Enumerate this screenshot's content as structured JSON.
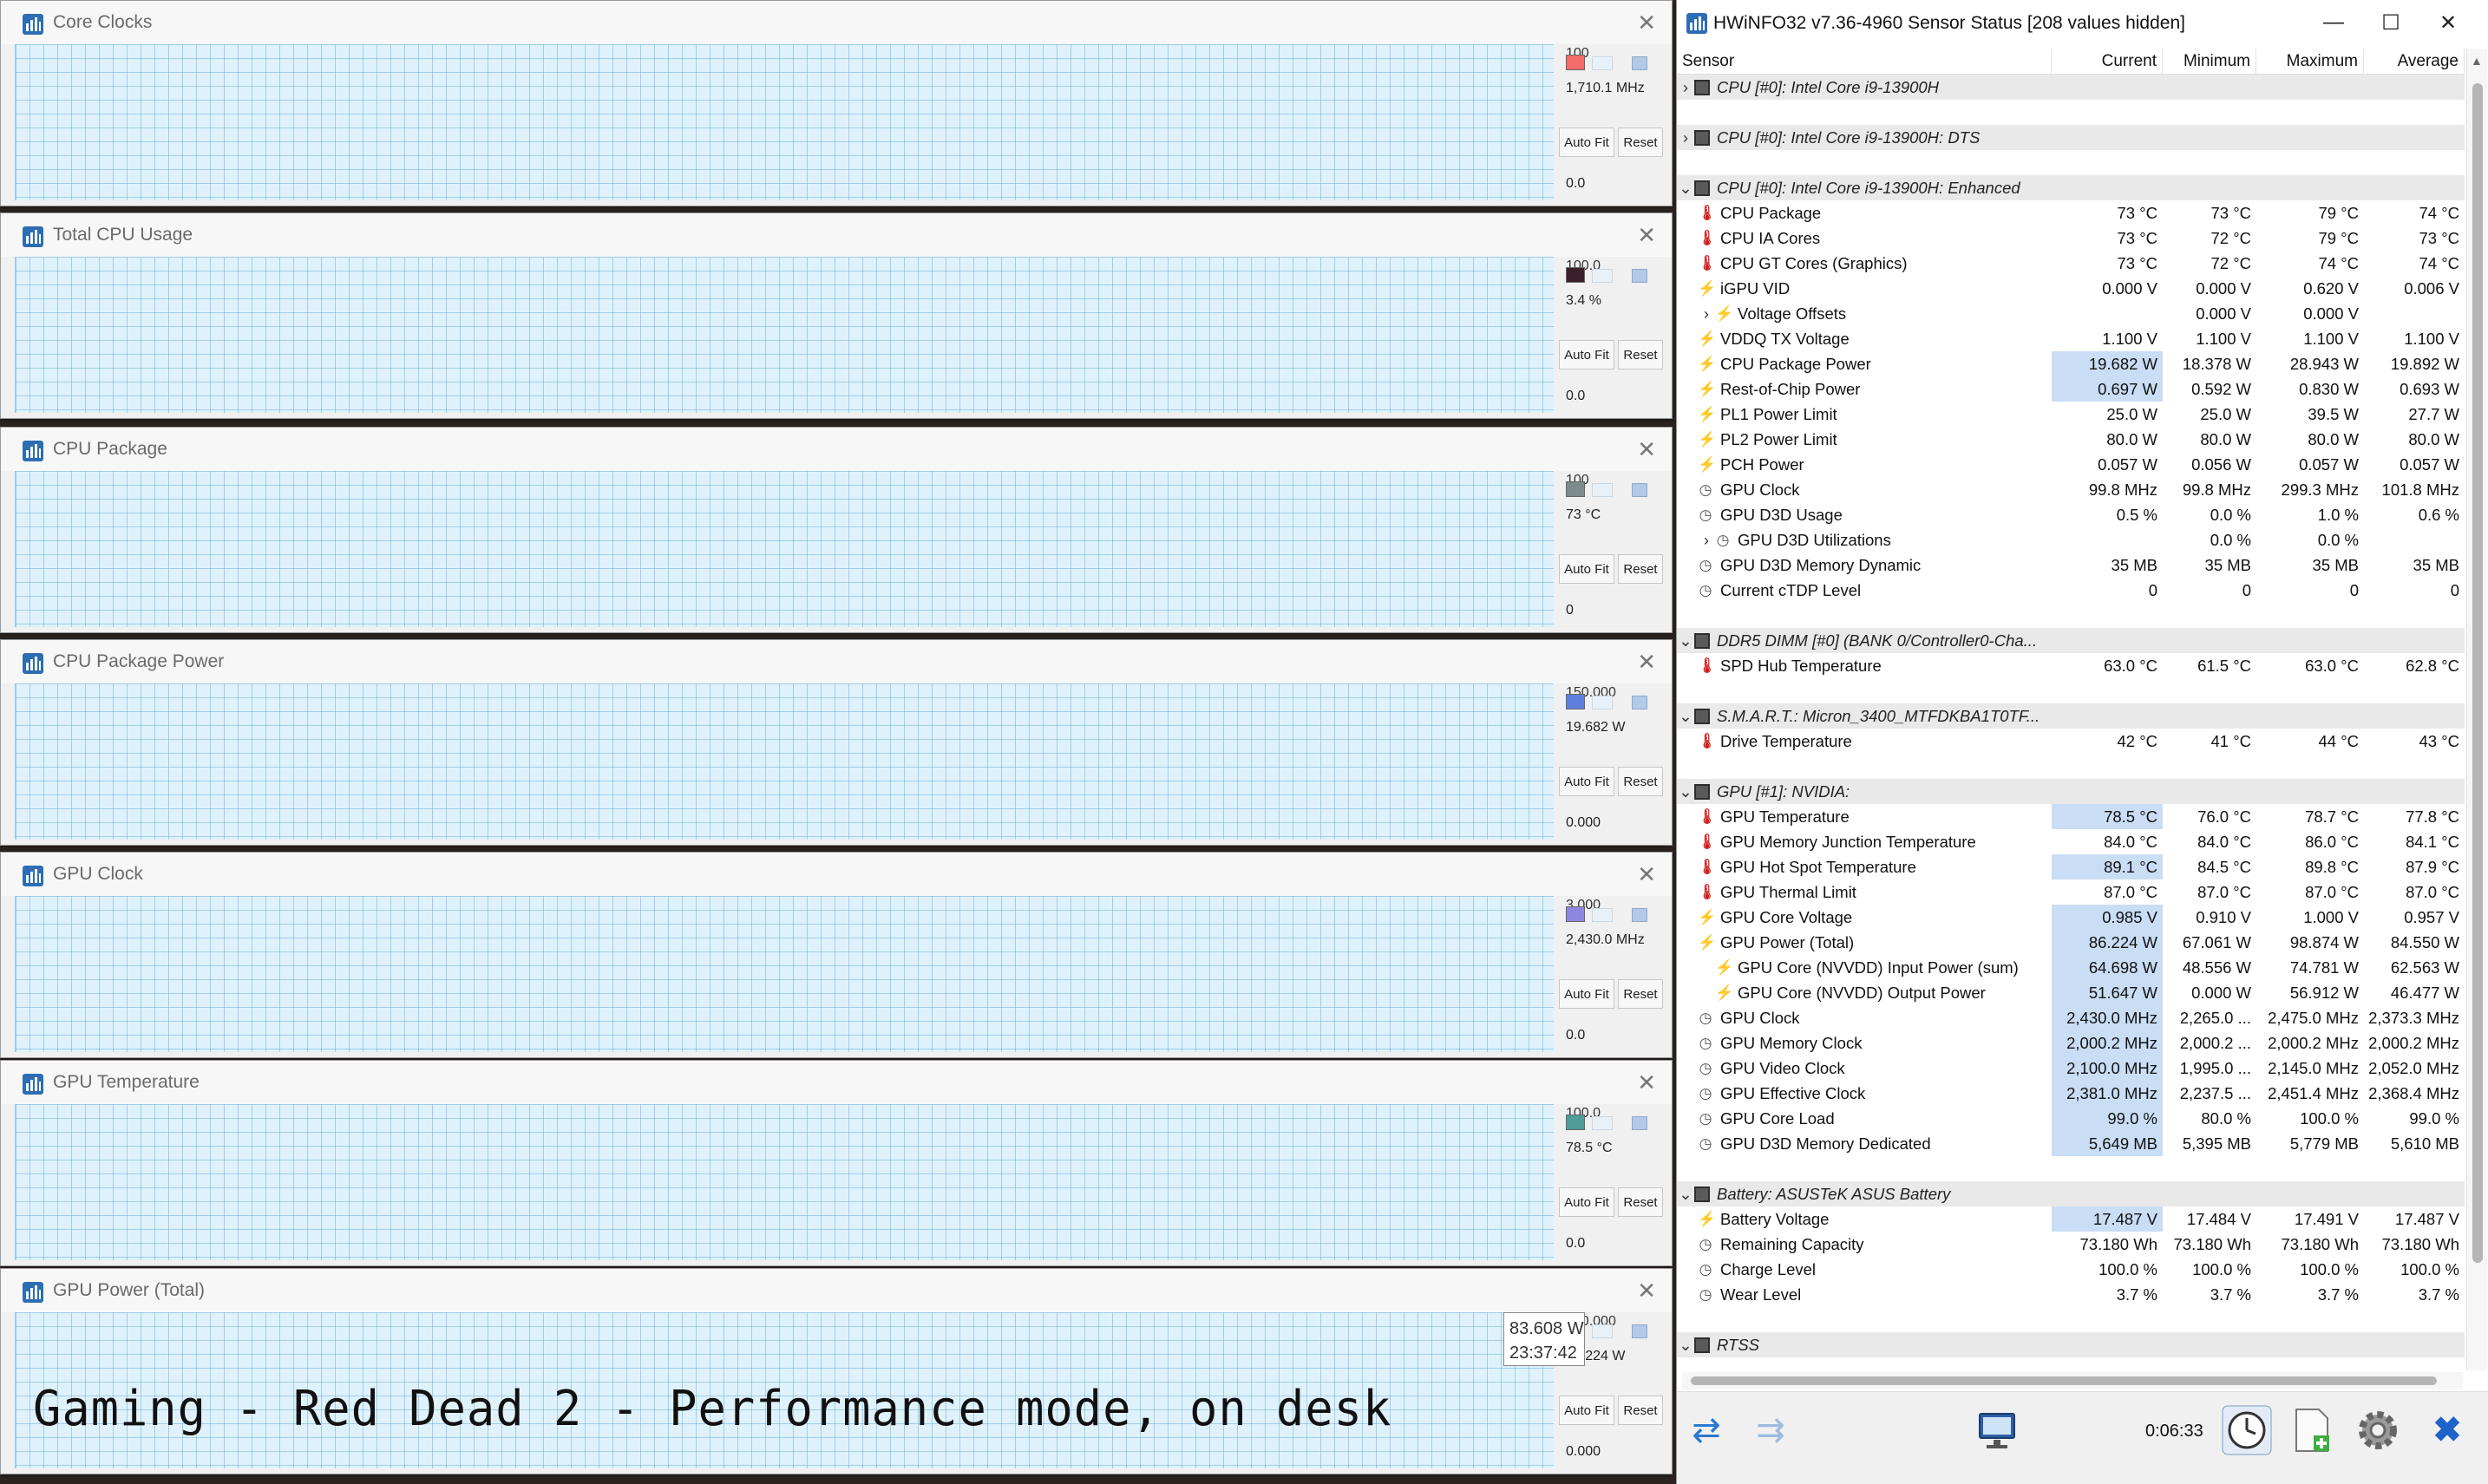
{
  "graphs": [
    {
      "title": "Core Clocks",
      "max": "100",
      "current": "1,710.1 MHz",
      "min": "0.0",
      "color": "#f46c6c",
      "fill": "#f4a3a3"
    },
    {
      "title": "Total CPU Usage",
      "max": "100.0",
      "current": "3.4 %",
      "min": "0.0",
      "color": "#3a1f2a",
      "fill": "#b9d6e6"
    },
    {
      "title": "CPU Package",
      "max": "100",
      "current": "73 °C",
      "min": "0",
      "color": "#7c8c8c",
      "fill": "#a9b4b4"
    },
    {
      "title": "CPU Package Power",
      "max": "150.000",
      "current": "19.682 W",
      "min": "0.000",
      "color": "#5f7fdf",
      "fill": "#8fa6e8"
    },
    {
      "title": "GPU Clock",
      "max": "3,000",
      "current": "2,430.0 MHz",
      "min": "0.0",
      "color": "#8f87e0",
      "fill": "#aca8ec"
    },
    {
      "title": "GPU Temperature",
      "max": "100.0",
      "current": "78.5 °C",
      "min": "0.0",
      "color": "#4f9c98",
      "fill": "#9fb9b7"
    },
    {
      "title": "GPU Power (Total)",
      "max": "200.000",
      "current": "84.224 W",
      "min": "0.000",
      "color": "#5a6a8a",
      "fill": "#9aa7bd"
    }
  ],
  "buttons": {
    "autofit": "Auto Fit",
    "reset": "Reset"
  },
  "tooltip": {
    "value": "83.608 W",
    "time": "23:37:42"
  },
  "caption": "Gaming - Red Dead 2 - Performance mode, on desk",
  "hwinfo": {
    "title": "HWiNFO32 v7.36-4960 Sensor Status [208 values hidden]",
    "columns": {
      "sensor": "Sensor",
      "current": "Current",
      "minimum": "Minimum",
      "maximum": "Maximum",
      "average": "Average"
    },
    "timer": "0:06:33"
  },
  "rows": [
    {
      "type": "group",
      "name": "CPU [#0]: Intel Core i9-13900H",
      "expand": "›"
    },
    {
      "type": "spacer"
    },
    {
      "type": "group",
      "name": "CPU [#0]: Intel Core i9-13900H: DTS",
      "expand": "›"
    },
    {
      "type": "spacer"
    },
    {
      "type": "group",
      "name": "CPU [#0]: Intel Core i9-13900H: Enhanced",
      "expand": "⌄"
    },
    {
      "type": "therm",
      "name": "CPU Package",
      "cur": "73 °C",
      "min": "73 °C",
      "max": "79 °C",
      "avg": "74 °C"
    },
    {
      "type": "therm",
      "name": "CPU IA Cores",
      "cur": "73 °C",
      "min": "72 °C",
      "max": "79 °C",
      "avg": "73 °C"
    },
    {
      "type": "therm",
      "name": "CPU GT Cores (Graphics)",
      "cur": "73 °C",
      "min": "72 °C",
      "max": "74 °C",
      "avg": "74 °C"
    },
    {
      "type": "volt",
      "name": "iGPU VID",
      "cur": "0.000 V",
      "min": "0.000 V",
      "max": "0.620 V",
      "avg": "0.006 V"
    },
    {
      "type": "volt",
      "name": "Voltage Offsets",
      "indent": 1,
      "expand": "›",
      "cur": "",
      "min": "0.000 V",
      "max": "0.000 V",
      "avg": ""
    },
    {
      "type": "volt",
      "name": "VDDQ TX Voltage",
      "cur": "1.100 V",
      "min": "1.100 V",
      "max": "1.100 V",
      "avg": "1.100 V"
    },
    {
      "type": "volt",
      "name": "CPU Package Power",
      "hl": true,
      "cur": "19.682 W",
      "min": "18.378 W",
      "max": "28.943 W",
      "avg": "19.892 W"
    },
    {
      "type": "volt",
      "name": "Rest-of-Chip Power",
      "hl": true,
      "cur": "0.697 W",
      "min": "0.592 W",
      "max": "0.830 W",
      "avg": "0.693 W"
    },
    {
      "type": "volt",
      "name": "PL1 Power Limit",
      "cur": "25.0 W",
      "min": "25.0 W",
      "max": "39.5 W",
      "avg": "27.7 W"
    },
    {
      "type": "volt",
      "name": "PL2 Power Limit",
      "cur": "80.0 W",
      "min": "80.0 W",
      "max": "80.0 W",
      "avg": "80.0 W"
    },
    {
      "type": "volt",
      "name": "PCH Power",
      "cur": "0.057 W",
      "min": "0.056 W",
      "max": "0.057 W",
      "avg": "0.057 W"
    },
    {
      "type": "clock",
      "name": "GPU Clock",
      "cur": "99.8 MHz",
      "min": "99.8 MHz",
      "max": "299.3 MHz",
      "avg": "101.8 MHz"
    },
    {
      "type": "clock",
      "name": "GPU D3D Usage",
      "cur": "0.5 %",
      "min": "0.0 %",
      "max": "1.0 %",
      "avg": "0.6 %"
    },
    {
      "type": "clock",
      "name": "GPU D3D Utilizations",
      "indent": 1,
      "expand": "›",
      "cur": "",
      "min": "0.0 %",
      "max": "0.0 %",
      "avg": ""
    },
    {
      "type": "clock",
      "name": "GPU D3D Memory Dynamic",
      "cur": "35 MB",
      "min": "35 MB",
      "max": "35 MB",
      "avg": "35 MB"
    },
    {
      "type": "clock",
      "name": "Current cTDP Level",
      "cur": "0",
      "min": "0",
      "max": "0",
      "avg": "0"
    },
    {
      "type": "spacer"
    },
    {
      "type": "group",
      "name": "DDR5 DIMM [#0] (BANK 0/Controller0-Cha...",
      "expand": "⌄"
    },
    {
      "type": "therm",
      "name": "SPD Hub Temperature",
      "cur": "63.0 °C",
      "min": "61.5 °C",
      "max": "63.0 °C",
      "avg": "62.8 °C"
    },
    {
      "type": "spacer"
    },
    {
      "type": "group",
      "name": "S.M.A.R.T.: Micron_3400_MTFDKBA1T0TF...",
      "expand": "⌄"
    },
    {
      "type": "therm",
      "name": "Drive Temperature",
      "cur": "42 °C",
      "min": "41 °C",
      "max": "44 °C",
      "avg": "43 °C"
    },
    {
      "type": "spacer"
    },
    {
      "type": "group",
      "name": "GPU [#1]: NVIDIA:",
      "expand": "⌄"
    },
    {
      "type": "therm",
      "name": "GPU Temperature",
      "hl": true,
      "cur": "78.5 °C",
      "min": "76.0 °C",
      "max": "78.7 °C",
      "avg": "77.8 °C"
    },
    {
      "type": "therm",
      "name": "GPU Memory Junction Temperature",
      "cur": "84.0 °C",
      "min": "84.0 °C",
      "max": "86.0 °C",
      "avg": "84.1 °C"
    },
    {
      "type": "therm",
      "name": "GPU Hot Spot Temperature",
      "hl": true,
      "cur": "89.1 °C",
      "min": "84.5 °C",
      "max": "89.8 °C",
      "avg": "87.9 °C"
    },
    {
      "type": "therm",
      "name": "GPU Thermal Limit",
      "cur": "87.0 °C",
      "min": "87.0 °C",
      "max": "87.0 °C",
      "avg": "87.0 °C"
    },
    {
      "type": "volt",
      "name": "GPU Core Voltage",
      "hl": true,
      "cur": "0.985 V",
      "min": "0.910 V",
      "max": "1.000 V",
      "avg": "0.957 V"
    },
    {
      "type": "volt",
      "name": "GPU Power (Total)",
      "hl": true,
      "cur": "86.224 W",
      "min": "67.061 W",
      "max": "98.874 W",
      "avg": "84.550 W"
    },
    {
      "type": "volt",
      "name": "GPU Core (NVVDD) Input Power (sum)",
      "indent": 1,
      "hl": true,
      "cur": "64.698 W",
      "min": "48.556 W",
      "max": "74.781 W",
      "avg": "62.563 W"
    },
    {
      "type": "volt",
      "name": "GPU Core (NVVDD) Output Power",
      "indent": 1,
      "hl": true,
      "cur": "51.647 W",
      "min": "0.000 W",
      "max": "56.912 W",
      "avg": "46.477 W"
    },
    {
      "type": "clock",
      "name": "GPU Clock",
      "hl": true,
      "cur": "2,430.0 MHz",
      "min": "2,265.0 ...",
      "max": "2,475.0 MHz",
      "avg": "2,373.3 MHz"
    },
    {
      "type": "clock",
      "name": "GPU Memory Clock",
      "hl": true,
      "cur": "2,000.2 MHz",
      "min": "2,000.2 ...",
      "max": "2,000.2 MHz",
      "avg": "2,000.2 MHz"
    },
    {
      "type": "clock",
      "name": "GPU Video Clock",
      "hl": true,
      "cur": "2,100.0 MHz",
      "min": "1,995.0 ...",
      "max": "2,145.0 MHz",
      "avg": "2,052.0 MHz"
    },
    {
      "type": "clock",
      "name": "GPU Effective Clock",
      "hl": true,
      "cur": "2,381.0 MHz",
      "min": "2,237.5 ...",
      "max": "2,451.4 MHz",
      "avg": "2,368.4 MHz"
    },
    {
      "type": "clock",
      "name": "GPU Core Load",
      "hl": true,
      "cur": "99.0 %",
      "min": "80.0 %",
      "max": "100.0 %",
      "avg": "99.0 %"
    },
    {
      "type": "clock",
      "name": "GPU D3D Memory Dedicated",
      "hl": true,
      "cur": "5,649 MB",
      "min": "5,395 MB",
      "max": "5,779 MB",
      "avg": "5,610 MB"
    },
    {
      "type": "spacer"
    },
    {
      "type": "group",
      "name": "Battery: ASUSTeK ASUS Battery",
      "expand": "⌄"
    },
    {
      "type": "volt",
      "name": "Battery Voltage",
      "hl": true,
      "cur": "17.487 V",
      "min": "17.484 V",
      "max": "17.491 V",
      "avg": "17.487 V"
    },
    {
      "type": "clock",
      "name": "Remaining Capacity",
      "cur": "73.180 Wh",
      "min": "73.180 Wh",
      "max": "73.180 Wh",
      "avg": "73.180 Wh"
    },
    {
      "type": "clock",
      "name": "Charge Level",
      "cur": "100.0 %",
      "min": "100.0 %",
      "max": "100.0 %",
      "avg": "100.0 %"
    },
    {
      "type": "clock",
      "name": "Wear Level",
      "cur": "3.7 %",
      "min": "3.7 %",
      "max": "3.7 %",
      "avg": "3.7 %"
    },
    {
      "type": "spacer"
    },
    {
      "type": "group",
      "name": "RTSS",
      "expand": "⌄"
    }
  ],
  "icons": {
    "therm": "thermometer-icon",
    "volt": "lightning-icon",
    "clock": "clock-icon"
  }
}
